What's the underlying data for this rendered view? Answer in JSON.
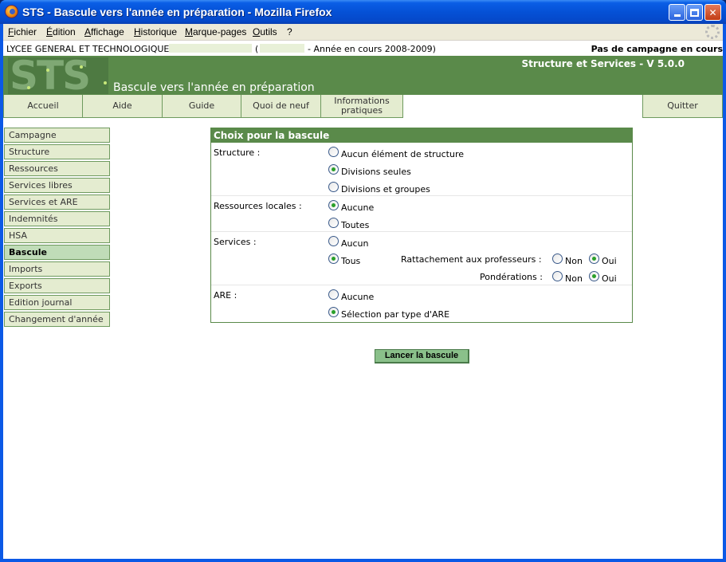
{
  "window": {
    "title": "STS - Bascule vers l'année en préparation - Mozilla Firefox"
  },
  "menu": [
    "Fichier",
    "Édition",
    "Affichage",
    "Historique",
    "Marque-pages",
    "Outils",
    "?"
  ],
  "info_bar": {
    "school_name": "LYCEE GENERAL ET TECHNOLOGIQUE",
    "paren": "(",
    "year": "- Année en cours 2008-2009)",
    "campaign_status": "Pas de campagne en cours"
  },
  "banner": {
    "logo": "STS",
    "app_version": "Structure et Services - V 5.0.0",
    "page_heading": "Bascule vers l'année en préparation"
  },
  "nav": {
    "home": "Accueil",
    "help": "Aide",
    "guide": "Guide",
    "whats_new": "Quoi de neuf",
    "info_1": "Informations",
    "info_2": "pratiques",
    "quit": "Quitter"
  },
  "sidebar": [
    "Campagne",
    "Structure",
    "Ressources",
    "Services libres",
    "Services et ARE",
    "Indemnités",
    "HSA",
    "Bascule",
    "Imports",
    "Exports",
    "Edition journal",
    "Changement d'année"
  ],
  "sidebar_active": "Bascule",
  "form": {
    "title": "Choix pour la bascule",
    "structure": {
      "label": "Structure :",
      "options": [
        "Aucun élément de structure",
        "Divisions seules",
        "Divisions et groupes"
      ],
      "selected": "Divisions seules"
    },
    "ressources": {
      "label": "Ressources locales :",
      "options": [
        "Aucune",
        "Toutes"
      ],
      "selected": "Aucune"
    },
    "services": {
      "label": "Services :",
      "options": [
        "Aucun",
        "Tous"
      ],
      "selected": "Tous",
      "rattachement_label": "Rattachement aux professeurs :",
      "ponderations_label": "Pondérations :",
      "non": "Non",
      "oui": "Oui",
      "rattachement_selected": "Oui",
      "ponderations_selected": "Oui"
    },
    "are": {
      "label": "ARE :",
      "options": [
        "Aucune",
        "Sélection par type d'ARE"
      ],
      "selected": "Sélection par type d'ARE"
    },
    "submit_label": "Lancer la bascule"
  }
}
